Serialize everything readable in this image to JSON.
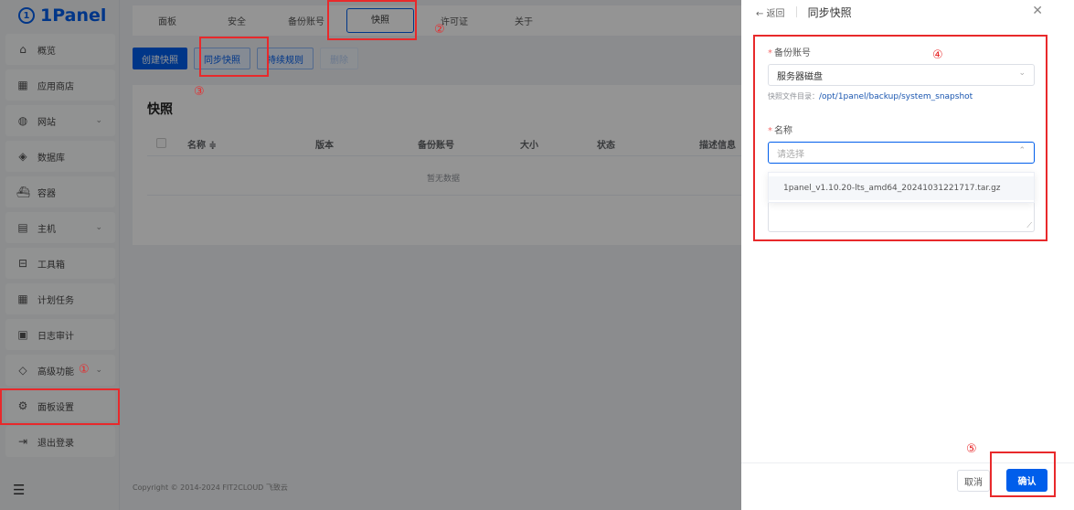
{
  "logo": {
    "mark": "1",
    "text": "1Panel"
  },
  "sidebar": {
    "items": [
      {
        "label": "概览",
        "icon": "⌂",
        "chevron": ""
      },
      {
        "label": "应用商店",
        "icon": "▦",
        "chevron": ""
      },
      {
        "label": "网站",
        "icon": "◍",
        "chevron": "⌄"
      },
      {
        "label": "数据库",
        "icon": "◈",
        "chevron": ""
      },
      {
        "label": "容器",
        "icon": "⛴",
        "chevron": ""
      },
      {
        "label": "主机",
        "icon": "▤",
        "chevron": "⌄"
      },
      {
        "label": "工具箱",
        "icon": "⊟",
        "chevron": ""
      },
      {
        "label": "计划任务",
        "icon": "▦",
        "chevron": ""
      },
      {
        "label": "日志审计",
        "icon": "▣",
        "chevron": ""
      },
      {
        "label": "高级功能",
        "icon": "◇",
        "chevron": "⌄"
      },
      {
        "label": "面板设置",
        "icon": "⚙",
        "chevron": ""
      },
      {
        "label": "退出登录",
        "icon": "⇥",
        "chevron": ""
      }
    ],
    "collapse_icon": "☰"
  },
  "tabs": [
    "面板",
    "安全",
    "备份账号",
    "快照",
    "许可证",
    "关于"
  ],
  "buttons": {
    "create": "创建快照",
    "sync": "同步快照",
    "rules": "持续规则",
    "delete": "删除"
  },
  "panel": {
    "title": "快照",
    "columns": [
      "名称 ≑",
      "版本",
      "备份账号",
      "大小",
      "状态",
      "描述信息"
    ],
    "empty": "暂无数据"
  },
  "footer": {
    "copyright": "Copyright © 2014-2024 FIT2CLOUD 飞致云"
  },
  "drawer": {
    "back": "← 返回",
    "title": "同步快照",
    "close": "✕",
    "account_label": "备份账号",
    "account_value": "服务器磁盘",
    "hint_prefix": "快照文件目录：",
    "hint_path": "/opt/1panel/backup/system_snapshot",
    "name_label": "名称",
    "name_placeholder": "请选择",
    "option": "1panel_v1.10.20-lts_amd64_20241031221717.tar.gz",
    "cancel": "取消",
    "confirm": "确认"
  },
  "annotations": [
    "①",
    "②",
    "③",
    "④",
    "⑤"
  ]
}
